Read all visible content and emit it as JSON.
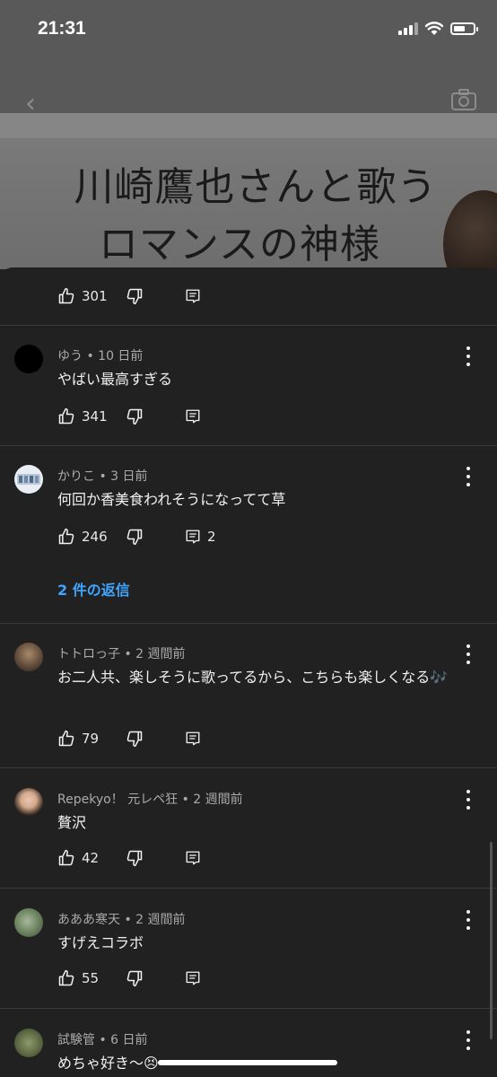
{
  "status_bar": {
    "time": "21:31"
  },
  "video": {
    "title_line1": "川崎鷹也さんと歌う",
    "title_line2": "ロマンスの神様"
  },
  "first_partial": {
    "likes": "301"
  },
  "comments": [
    {
      "author": "ゆう",
      "time": "10 日前",
      "text": "やばい最高すぎる",
      "likes": "341",
      "replies": ""
    },
    {
      "author": "かりこ",
      "time": "3 日前",
      "text": "何回か香美食われそうになってて草",
      "likes": "246",
      "replies": "2",
      "reply_link": "2 件の返信"
    },
    {
      "author": "トトロっ子",
      "time": "2 週間前",
      "text": "お二人共、楽しそうに歌ってるから、こちらも楽しくなる🎶",
      "likes": "79",
      "replies": ""
    },
    {
      "author": "Repekyo！ 元レペ狂",
      "time": "2 週間前",
      "text": "贅沢",
      "likes": "42",
      "replies": ""
    },
    {
      "author": "あああ寒天",
      "time": "2 週間前",
      "text": "すげえコラボ",
      "likes": "55",
      "replies": ""
    },
    {
      "author": "試験管",
      "time": "6 日前",
      "text": "めちゃ好き〜😣",
      "likes": "",
      "replies": ""
    }
  ],
  "icons": {
    "like": "thumb-up-icon",
    "dislike": "thumb-down-icon",
    "reply": "comment-icon",
    "more": "more-vert-icon"
  },
  "colors": {
    "background": "#212121",
    "link": "#3ea6ff",
    "meta": "#aaaaaa"
  }
}
